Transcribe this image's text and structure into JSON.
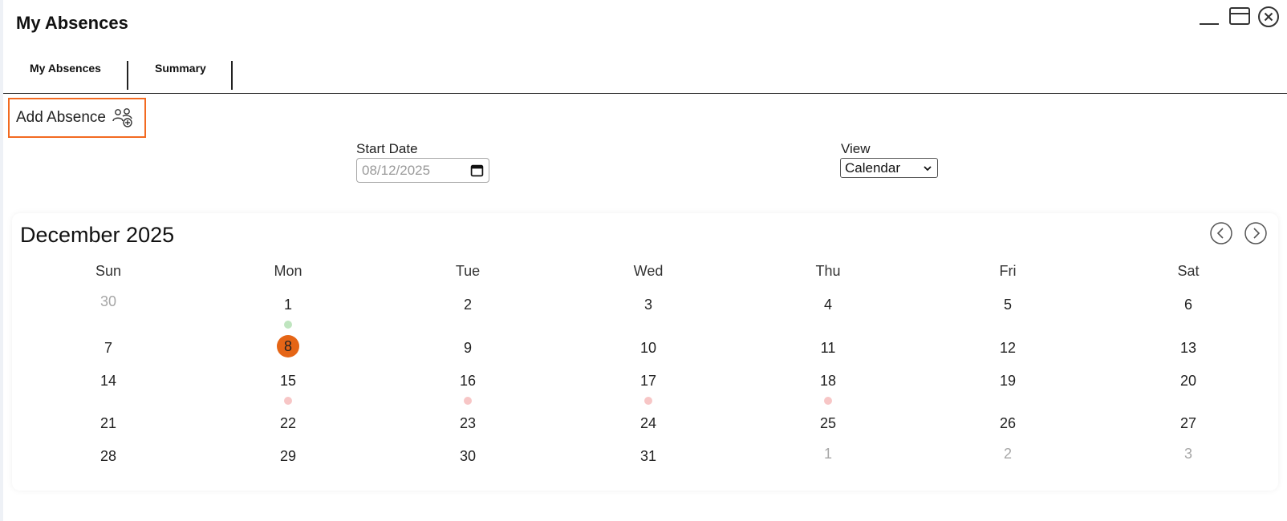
{
  "window": {
    "title": "My Absences"
  },
  "tabs": [
    {
      "label": "My Absences"
    },
    {
      "label": "Summary"
    }
  ],
  "toolbar": {
    "add_label": "Add Absence",
    "add_icon": "users-add-icon"
  },
  "filters": {
    "start_date_label": "Start Date",
    "start_date_value": "08/12/2025",
    "view_label": "View",
    "view_value": "Calendar"
  },
  "calendar": {
    "month_title": "December 2025",
    "weekdays": [
      "Sun",
      "Mon",
      "Tue",
      "Wed",
      "Thu",
      "Fri",
      "Sat"
    ],
    "weeks": [
      [
        "30",
        "1",
        "2",
        "3",
        "4",
        "5",
        "6"
      ],
      [
        "7",
        "8",
        "9",
        "10",
        "11",
        "12",
        "13"
      ],
      [
        "14",
        "15",
        "16",
        "17",
        "18",
        "19",
        "20"
      ],
      [
        "21",
        "22",
        "23",
        "24",
        "25",
        "26",
        "27"
      ],
      [
        "28",
        "29",
        "30",
        "31",
        "1",
        "2",
        "3"
      ]
    ],
    "today": "8",
    "colors": {
      "accent": "#f26a21",
      "today": "#e56516",
      "approved_dot": "#bfe5bf",
      "pending_dot": "#f7c6c6",
      "muted_text": "#a6a6a6"
    }
  }
}
